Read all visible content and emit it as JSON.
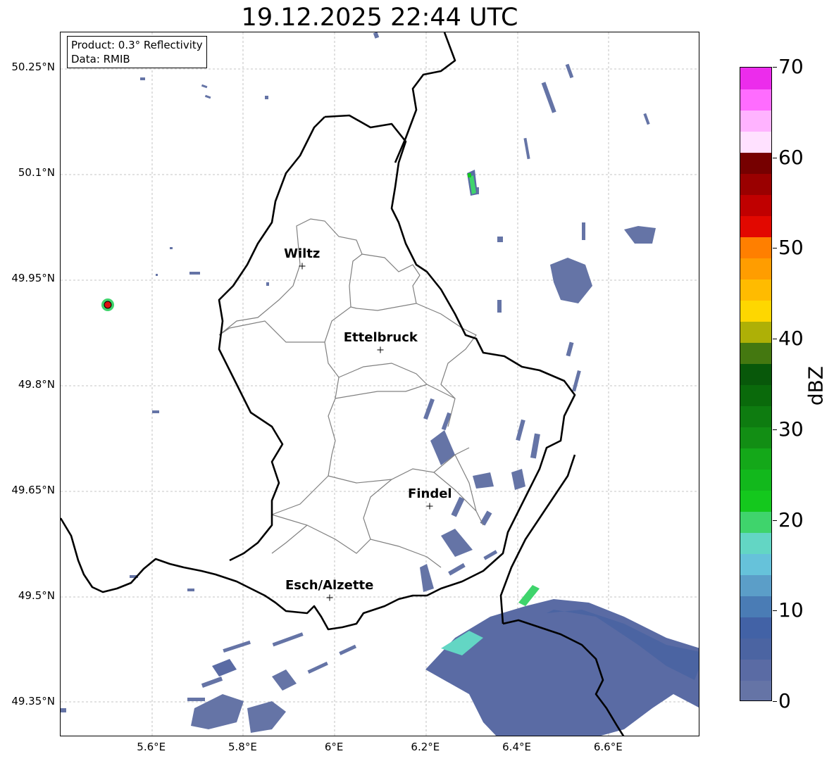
{
  "title": "19.12.2025 22:44 UTC",
  "info": {
    "product": "Product: 0.3° Reflectivity",
    "data": "Data: RMIB"
  },
  "map_extent": {
    "lon_min": 5.4,
    "lon_max": 6.8,
    "lat_min": 49.3,
    "lat_max": 50.3
  },
  "lat_ticks": [
    {
      "value": 50.25,
      "label": "50.25°N"
    },
    {
      "value": 50.1,
      "label": "50.1°N"
    },
    {
      "value": 49.95,
      "label": "49.95°N"
    },
    {
      "value": 49.8,
      "label": "49.8°N"
    },
    {
      "value": 49.65,
      "label": "49.65°N"
    },
    {
      "value": 49.5,
      "label": "49.5°N"
    },
    {
      "value": 49.35,
      "label": "49.35°N"
    }
  ],
  "lon_ticks": [
    {
      "value": 5.6,
      "label": "5.6°E"
    },
    {
      "value": 5.8,
      "label": "5.8°E"
    },
    {
      "value": 6.0,
      "label": "6°E"
    },
    {
      "value": 6.2,
      "label": "6.2°E"
    },
    {
      "value": 6.4,
      "label": "6.4°E"
    },
    {
      "value": 6.6,
      "label": "6.6°E"
    }
  ],
  "cities": [
    {
      "name": "Wiltz",
      "lon": 5.93,
      "lat": 49.967
    },
    {
      "name": "Ettelbruck",
      "lon": 6.102,
      "lat": 49.848
    },
    {
      "name": "Findel",
      "lon": 6.21,
      "lat": 49.627
    },
    {
      "name": "Esch/Alzette",
      "lon": 5.99,
      "lat": 49.497
    }
  ],
  "radar_site": {
    "lon": 5.505,
    "lat": 49.915,
    "color": "#dd1111"
  },
  "colorbar": {
    "label": "dBZ",
    "min": 0,
    "max": 70,
    "ticks": [
      "0",
      "10",
      "20",
      "30",
      "40",
      "50",
      "60",
      "70"
    ],
    "colors": [
      "#6574a6",
      "#5a6ba4",
      "#4b64a2",
      "#4262a6",
      "#4a7cb5",
      "#5b9ec8",
      "#66c2da",
      "#63d6c4",
      "#3fd46c",
      "#14c81d",
      "#12b81c",
      "#14a819",
      "#128e14",
      "#0e7c10",
      "#0a6a0b",
      "#08580a",
      "#447810",
      "#aeb006",
      "#fed700",
      "#ffbb00",
      "#ff9d00",
      "#ff7f00",
      "#e20800",
      "#c00000",
      "#9a0000",
      "#760000",
      "#ffe1ff",
      "#ffb3ff",
      "#ff6cff",
      "#ec2cec"
    ]
  },
  "colors": {
    "country_border": "#000000",
    "canton_border": "#808080",
    "grid": "#b4b4b4",
    "echo": "#6574a6"
  }
}
